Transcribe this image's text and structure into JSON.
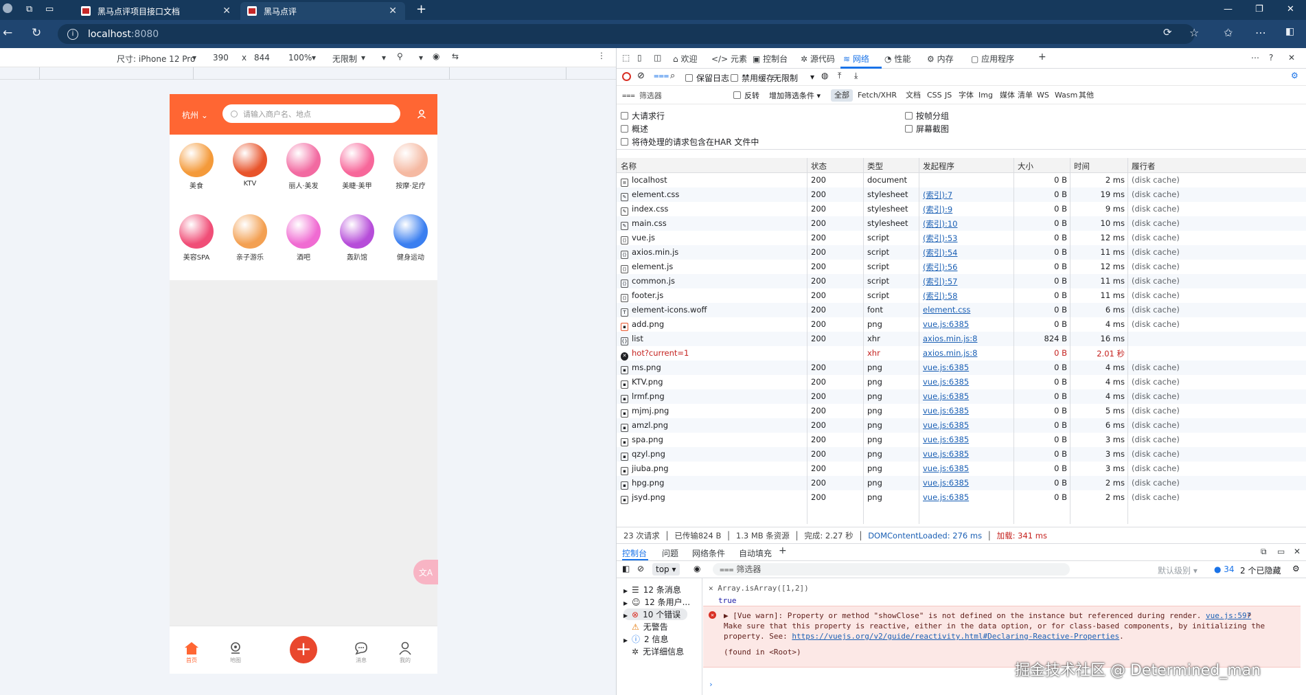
{
  "browser": {
    "tabs": [
      {
        "title": "黑马点评项目接口文档",
        "active": false
      },
      {
        "title": "黑马点评",
        "active": true
      }
    ],
    "url_host": "localhost",
    "url_port": ":8080",
    "window_controls": {
      "minimize": "—",
      "restore": "❐",
      "close": "✕"
    }
  },
  "device_toolbar": {
    "size_label": "尺寸: iPhone 12 Pro",
    "width": "390",
    "times": "x",
    "height": "844",
    "zoom": "100%",
    "throttle": "无限制"
  },
  "app": {
    "city": "杭州",
    "search_placeholder": "请输入商户名、地点",
    "categories": [
      {
        "name": "美食",
        "icon": "roast-chicken-icon",
        "color": "#f49a3a"
      },
      {
        "name": "KTV",
        "icon": "microphone-icon",
        "color": "#e8542b"
      },
      {
        "name": "丽人·美发",
        "icon": "hair-icon",
        "color": "#f26aa1"
      },
      {
        "name": "美睫·美甲",
        "icon": "nail-icon",
        "color": "#f7679a"
      },
      {
        "name": "按摩·足疗",
        "icon": "massage-icon",
        "color": "#f5b9a2"
      },
      {
        "name": "美容SPA",
        "icon": "face-mask-icon",
        "color": "#f04e77"
      },
      {
        "name": "亲子游乐",
        "icon": "parent-child-icon",
        "color": "#f3a052"
      },
      {
        "name": "酒吧",
        "icon": "cocktail-icon",
        "color": "#f06bd2"
      },
      {
        "name": "轰趴馆",
        "icon": "party-mask-icon",
        "color": "#b64dd9"
      },
      {
        "name": "健身运动",
        "icon": "dumbbell-icon",
        "color": "#3b7ff0"
      }
    ],
    "float_button": "文A",
    "footer": [
      {
        "label": "首页",
        "icon": "home-icon",
        "active": true
      },
      {
        "label": "地图",
        "icon": "map-pin-icon",
        "active": false
      },
      {
        "label": "",
        "icon": "add-icon",
        "active": false
      },
      {
        "label": "消息",
        "icon": "message-icon",
        "active": false
      },
      {
        "label": "我的",
        "icon": "user-icon",
        "active": false
      }
    ]
  },
  "devtools": {
    "tabs": [
      "欢迎",
      "元素",
      "控制台",
      "源代码",
      "网络",
      "性能",
      "内存",
      "应用程序"
    ],
    "active_tab": "网络",
    "network_toolbar": {
      "preserve_log": "保留日志",
      "disable_cache": "禁用缓存",
      "throttle": "无限制"
    },
    "filter": {
      "placeholder": "筛选器",
      "invert": "反转",
      "more_filters": "增加筛选条件",
      "types": [
        "全部",
        "Fetch/XHR",
        "文档",
        "CSS",
        "JS",
        "字体",
        "Img",
        "媒体",
        "清单",
        "WS",
        "Wasm",
        "其他"
      ]
    },
    "options": {
      "big_rows": "大请求行",
      "group_by_frame": "按帧分组",
      "overview": "概述",
      "screenshots": "屏幕截图",
      "har": "将待处理的请求包含在HAR 文件中"
    },
    "columns": [
      "名称",
      "状态",
      "类型",
      "发起程序",
      "大小",
      "时间",
      "履行者"
    ],
    "rows": [
      {
        "name": "localhost",
        "status": "200",
        "type": "document",
        "initiator": "",
        "size": "0 B",
        "time": "2 ms",
        "fulfilled": "(disk cache)",
        "icon": "doc",
        "error": false
      },
      {
        "name": "element.css",
        "status": "200",
        "type": "stylesheet",
        "initiator": "(索引):7",
        "size": "0 B",
        "time": "19 ms",
        "fulfilled": "(disk cache)",
        "icon": "css",
        "error": false
      },
      {
        "name": "index.css",
        "status": "200",
        "type": "stylesheet",
        "initiator": "(索引):9",
        "size": "0 B",
        "time": "9 ms",
        "fulfilled": "(disk cache)",
        "icon": "css",
        "error": false
      },
      {
        "name": "main.css",
        "status": "200",
        "type": "stylesheet",
        "initiator": "(索引):10",
        "size": "0 B",
        "time": "10 ms",
        "fulfilled": "(disk cache)",
        "icon": "css",
        "error": false
      },
      {
        "name": "vue.js",
        "status": "200",
        "type": "script",
        "initiator": "(索引):53",
        "size": "0 B",
        "time": "12 ms",
        "fulfilled": "(disk cache)",
        "icon": "js",
        "error": false
      },
      {
        "name": "axios.min.js",
        "status": "200",
        "type": "script",
        "initiator": "(索引):54",
        "size": "0 B",
        "time": "11 ms",
        "fulfilled": "(disk cache)",
        "icon": "js",
        "error": false
      },
      {
        "name": "element.js",
        "status": "200",
        "type": "script",
        "initiator": "(索引):56",
        "size": "0 B",
        "time": "12 ms",
        "fulfilled": "(disk cache)",
        "icon": "js",
        "error": false
      },
      {
        "name": "common.js",
        "status": "200",
        "type": "script",
        "initiator": "(索引):57",
        "size": "0 B",
        "time": "11 ms",
        "fulfilled": "(disk cache)",
        "icon": "js",
        "error": false
      },
      {
        "name": "footer.js",
        "status": "200",
        "type": "script",
        "initiator": "(索引):58",
        "size": "0 B",
        "time": "11 ms",
        "fulfilled": "(disk cache)",
        "icon": "js",
        "error": false
      },
      {
        "name": "element-icons.woff",
        "status": "200",
        "type": "font",
        "initiator": "element.css",
        "size": "0 B",
        "time": "6 ms",
        "fulfilled": "(disk cache)",
        "icon": "font",
        "error": false
      },
      {
        "name": "add.png",
        "status": "200",
        "type": "png",
        "initiator": "vue.js:6385",
        "size": "0 B",
        "time": "4 ms",
        "fulfilled": "(disk cache)",
        "icon": "img",
        "error": false
      },
      {
        "name": "list",
        "status": "200",
        "type": "xhr",
        "initiator": "axios.min.js:8",
        "size": "824 B",
        "time": "16 ms",
        "fulfilled": "",
        "icon": "xhr",
        "error": false
      },
      {
        "name": "hot?current=1",
        "status": "",
        "type": "xhr",
        "initiator": "axios.min.js:8",
        "size": "0 B",
        "time": "2.01 秒",
        "fulfilled": "",
        "icon": "error",
        "error": true
      },
      {
        "name": "ms.png",
        "status": "200",
        "type": "png",
        "initiator": "vue.js:6385",
        "size": "0 B",
        "time": "4 ms",
        "fulfilled": "(disk cache)",
        "icon": "img",
        "error": false
      },
      {
        "name": "KTV.png",
        "status": "200",
        "type": "png",
        "initiator": "vue.js:6385",
        "size": "0 B",
        "time": "4 ms",
        "fulfilled": "(disk cache)",
        "icon": "img",
        "error": false
      },
      {
        "name": "lrmf.png",
        "status": "200",
        "type": "png",
        "initiator": "vue.js:6385",
        "size": "0 B",
        "time": "4 ms",
        "fulfilled": "(disk cache)",
        "icon": "img",
        "error": false
      },
      {
        "name": "mjmj.png",
        "status": "200",
        "type": "png",
        "initiator": "vue.js:6385",
        "size": "0 B",
        "time": "5 ms",
        "fulfilled": "(disk cache)",
        "icon": "img",
        "error": false
      },
      {
        "name": "amzl.png",
        "status": "200",
        "type": "png",
        "initiator": "vue.js:6385",
        "size": "0 B",
        "time": "6 ms",
        "fulfilled": "(disk cache)",
        "icon": "img",
        "error": false
      },
      {
        "name": "spa.png",
        "status": "200",
        "type": "png",
        "initiator": "vue.js:6385",
        "size": "0 B",
        "time": "3 ms",
        "fulfilled": "(disk cache)",
        "icon": "img",
        "error": false
      },
      {
        "name": "qzyl.png",
        "status": "200",
        "type": "png",
        "initiator": "vue.js:6385",
        "size": "0 B",
        "time": "3 ms",
        "fulfilled": "(disk cache)",
        "icon": "img",
        "error": false
      },
      {
        "name": "jiuba.png",
        "status": "200",
        "type": "png",
        "initiator": "vue.js:6385",
        "size": "0 B",
        "time": "3 ms",
        "fulfilled": "(disk cache)",
        "icon": "img",
        "error": false
      },
      {
        "name": "hpg.png",
        "status": "200",
        "type": "png",
        "initiator": "vue.js:6385",
        "size": "0 B",
        "time": "2 ms",
        "fulfilled": "(disk cache)",
        "icon": "img",
        "error": false
      },
      {
        "name": "jsyd.png",
        "status": "200",
        "type": "png",
        "initiator": "vue.js:6385",
        "size": "0 B",
        "time": "2 ms",
        "fulfilled": "(disk cache)",
        "icon": "img",
        "error": false
      }
    ],
    "summary": {
      "requests": "23 次请求",
      "transferred": "已传输824 B",
      "resources": "1.3 MB 条资源",
      "finish": "完成: 2.27 秒",
      "dcl": "DOMContentLoaded: 276 ms",
      "load": "加载: 341 ms"
    },
    "drawer_tabs": [
      "控制台",
      "问题",
      "网络条件",
      "自动填充"
    ],
    "console_toolbar": {
      "context": "top",
      "filter": "筛选器",
      "level": "默认级别",
      "issues_count": "34",
      "hidden": "2 个已隐藏"
    },
    "console_sidebar": [
      {
        "label": "12 条消息",
        "icon": "list-icon"
      },
      {
        "label": "12 条用户...",
        "icon": "user-circle-icon"
      },
      {
        "label": "10 个错误",
        "icon": "error-icon"
      },
      {
        "label": "无警告",
        "icon": "warning-icon"
      },
      {
        "label": "2 信息",
        "icon": "info-icon"
      },
      {
        "label": "无详细信息",
        "icon": "bug-icon"
      }
    ],
    "console": {
      "input_expr": "Array.isArray([1,2])",
      "result": "true",
      "warn_line1": "[Vue warn]: Property or method \"showClose\" is not defined on the instance but referenced during render.",
      "warn_line2": "Make sure that this property is reactive, either in the data option, or for class-based components, by initializing the",
      "warn_line3_prefix": "property. See: ",
      "warn_link": "https://vuejs.org/v2/guide/reactivity.html#Declaring-Reactive-Properties",
      "warn_line3_suffix": ".",
      "warn_source": "vue.js:597",
      "found_in": "(found in <Root>)"
    }
  },
  "watermark": "掘金技术社区 @ Determined_man"
}
